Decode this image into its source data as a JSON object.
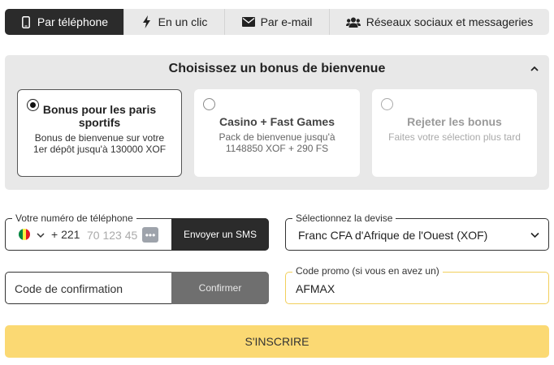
{
  "tabs": [
    {
      "label": "Par téléphone",
      "icon": "phone-icon",
      "active": true
    },
    {
      "label": "En un clic",
      "icon": "lightning-icon",
      "active": false
    },
    {
      "label": "Par e-mail",
      "icon": "envelope-icon",
      "active": false
    },
    {
      "label": "Réseaux sociaux et messageries",
      "icon": "users-icon",
      "active": false
    }
  ],
  "bonus": {
    "title": "Choisissez un bonus de bienvenue",
    "cards": [
      {
        "title": "Bonus pour les paris sportifs",
        "desc": "Bonus de bienvenue sur votre 1er dépôt jusqu'à 130000 XOF",
        "selected": true
      },
      {
        "title": "Casino + Fast Games",
        "desc": "Pack de bienvenue jusqu'à 1148850 XOF + 290 FS",
        "selected": false
      },
      {
        "title": "Rejeter les bonus",
        "desc": "Faites votre sélection plus tard",
        "selected": false
      }
    ]
  },
  "phone": {
    "label": "Votre numéro de téléphone",
    "dial_code": "+ 221",
    "placeholder": "70 123 45",
    "send_sms": "Envoyer un SMS",
    "dots": "•••"
  },
  "currency": {
    "label": "Sélectionnez la devise",
    "value": "Franc CFA d'Afrique de l'Ouest (XOF)"
  },
  "confirmation": {
    "placeholder": "Code de confirmation",
    "button": "Confirmer"
  },
  "promo": {
    "label": "Code promo (si vous en avez un)",
    "value": "AFMAX"
  },
  "submit": "S'INSCRIRE",
  "colors": {
    "accent": "#fbd973",
    "dark": "#2b2b2b",
    "promo_border": "#f2cf5b",
    "flag_green": "#00853f",
    "flag_yellow": "#fdef42",
    "flag_red": "#e31b23"
  }
}
